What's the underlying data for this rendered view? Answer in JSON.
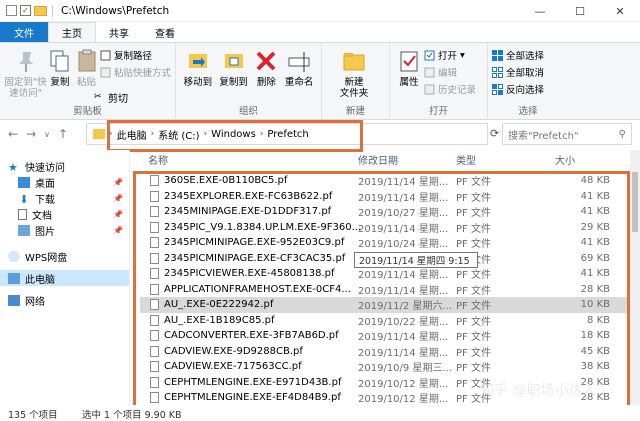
{
  "title": "C:\\Windows\\Prefetch",
  "ribbon_tabs": [
    "文件",
    "主页",
    "共享",
    "查看"
  ],
  "ribbon": {
    "clipboard": {
      "pin": "固定到\"快速访问\"",
      "copy": "复制",
      "paste": "粘贴",
      "cut": "剪切",
      "copy_path": "复制路径",
      "paste_shortcut": "粘贴快捷方式",
      "label": "剪贴板"
    },
    "organize": {
      "move_to": "移动到",
      "copy_to": "复制到",
      "delete": "删除",
      "rename": "重命名",
      "label": "组织"
    },
    "new": {
      "new_folder": "新建\n文件夹",
      "label": "新建"
    },
    "open": {
      "properties": "属性",
      "open": "打开",
      "edit": "编辑",
      "history": "历史记录",
      "label": "打开"
    },
    "select": {
      "select_all": "全部选择",
      "select_none": "全部取消",
      "invert": "反向选择",
      "label": "选择"
    }
  },
  "breadcrumb": [
    "此电脑",
    "系统 (C:)",
    "Windows",
    "Prefetch"
  ],
  "search_placeholder": "搜索\"Prefetch\"",
  "sidebar": [
    {
      "label": "快速访问",
      "pin": false
    },
    {
      "label": "桌面",
      "pin": true
    },
    {
      "label": "下载",
      "pin": true
    },
    {
      "label": "文档",
      "pin": true
    },
    {
      "label": "图片",
      "pin": true
    },
    {
      "label": "WPS网盘",
      "pin": false
    },
    {
      "label": "此电脑",
      "pin": false
    },
    {
      "label": "网络",
      "pin": false
    }
  ],
  "columns": {
    "name": "名称",
    "date": "修改日期",
    "type": "类型",
    "size": "大小"
  },
  "files": [
    {
      "name": "360SE.EXE-0B110BC5.pf",
      "date": "2019/11/14 星期...",
      "type": "PF 文件",
      "size": "48 KB"
    },
    {
      "name": "2345EXPLORER.EXE-FC63B622.pf",
      "date": "2019/11/14 星期...",
      "type": "PF 文件",
      "size": "41 KB"
    },
    {
      "name": "2345MINIPAGE.EXE-D1DDF317.pf",
      "date": "2019/10/27 星期...",
      "type": "PF 文件",
      "size": "41 KB"
    },
    {
      "name": "2345PIC_V9.1.8384.UP.LM.EXE-9F360...",
      "date": "2019/11/14 星期...",
      "type": "PF 文件",
      "size": "29 KB"
    },
    {
      "name": "2345PICMINIPAGE.EXE-952E03C9.pf",
      "date": "2019/10/24 星期...",
      "type": "PF 文件",
      "size": "41 KB"
    },
    {
      "name": "2345PICMINIPAGE.EXE-CF3CAC35.pf",
      "date": "2019/11/14 星期...",
      "type": "PF 文件",
      "size": "69 KB"
    },
    {
      "name": "2345PICVIEWER.EXE-45808138.pf",
      "date": "2019/11/14 星期...",
      "type": "PF 文件",
      "size": "41 KB"
    },
    {
      "name": "APPLICATIONFRAMEHOST.EXE-0CF4...",
      "date": "2019/11/14 星期...",
      "type": "PF 文件",
      "size": "28 KB"
    },
    {
      "name": "AU_.EXE-0E222942.pf",
      "date": "2019/11/2 星期六...",
      "type": "PF 文件",
      "size": "10 KB"
    },
    {
      "name": "AU_.EXE-1B189C85.pf",
      "date": "2019/10/22 星期...",
      "type": "PF 文件",
      "size": "8 KB"
    },
    {
      "name": "CADCONVERTER.EXE-3FB7AB6D.pf",
      "date": "2019/11/14 星期...",
      "type": "PF 文件",
      "size": "18 KB"
    },
    {
      "name": "CADVIEW.EXE-9D9288CB.pf",
      "date": "2019/11/14 星期...",
      "type": "PF 文件",
      "size": "45 KB"
    },
    {
      "name": "CADVIEW.EXE-717563CC.pf",
      "date": "2019/10/9 星期三...",
      "type": "PF 文件",
      "size": "38 KB"
    },
    {
      "name": "CEPHTMLENGINE.EXE-E971D43B.pf",
      "date": "2019/10/12 星期...",
      "type": "PF 文件",
      "size": "28 KB"
    },
    {
      "name": "CEPHTMLENGINE.EXE-EF4D84B9.pf",
      "date": "2019/10/12 星期...",
      "type": "PF 文件",
      "size": "28 KB"
    }
  ],
  "tooltip": "2019/11/14 星期四 9:15",
  "status": {
    "count": "135 个项目",
    "selected": "选中 1 个项目  9.90 KB"
  },
  "watermark": "知乎 @职场小达人",
  "colors": {
    "accent": "#1979ca",
    "highlight": "#e0703a",
    "selected_row": "#d9d9d9"
  }
}
